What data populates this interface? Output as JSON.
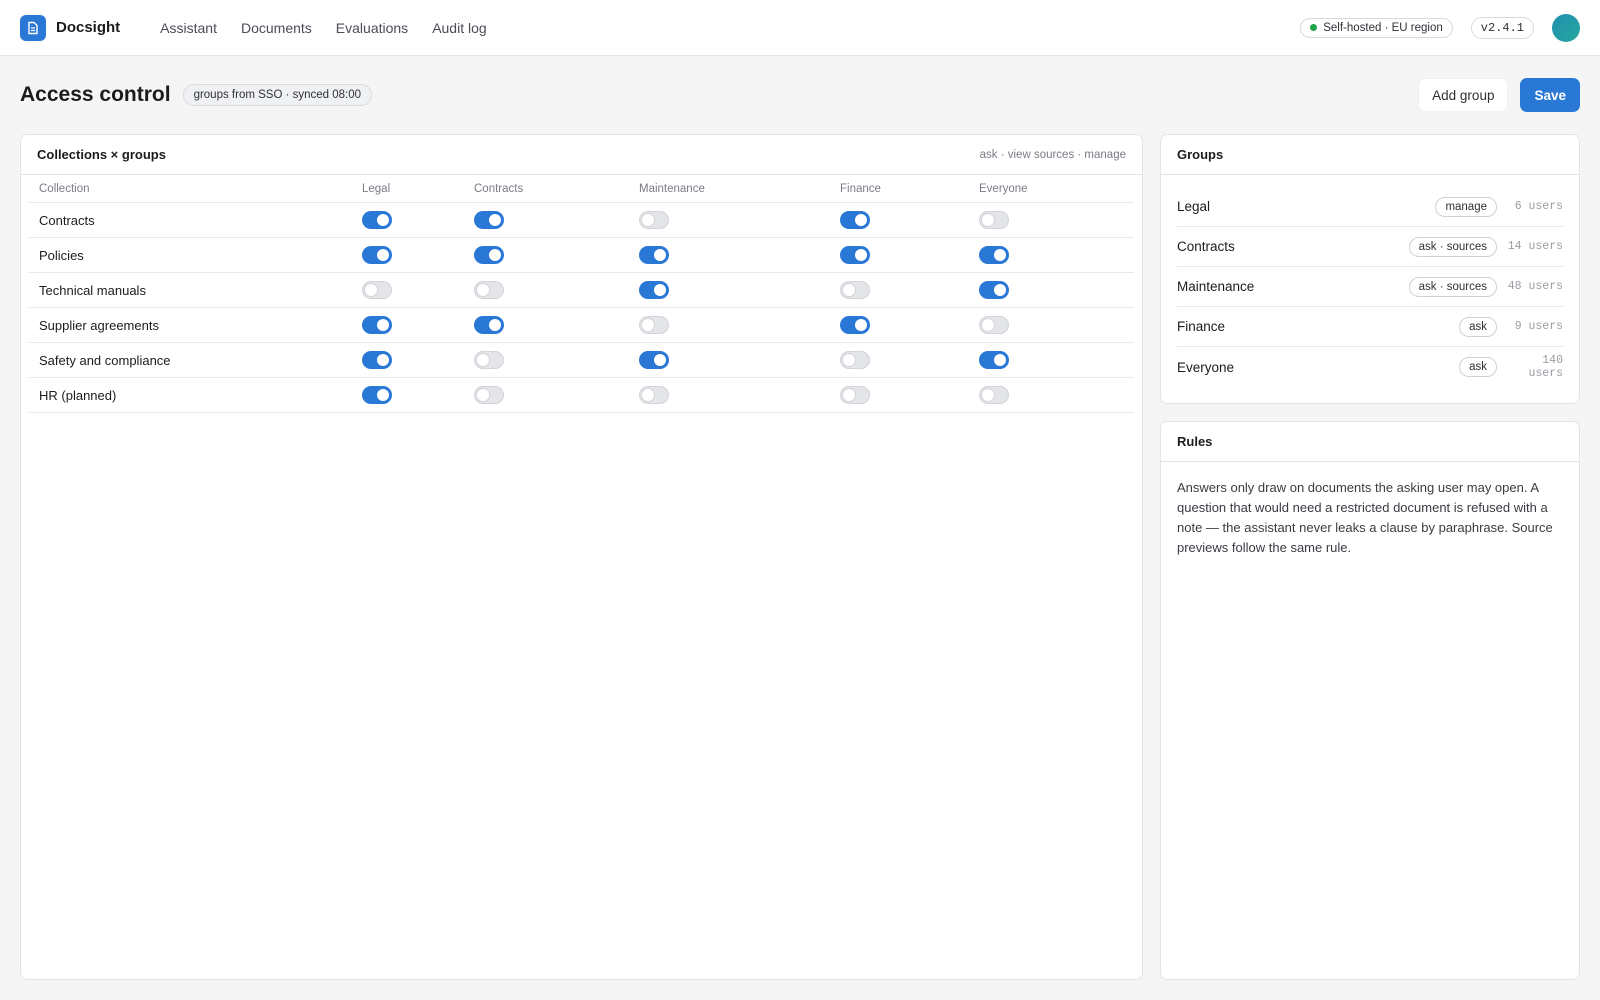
{
  "app": {
    "name": "Docsight"
  },
  "nav": [
    "Assistant",
    "Documents",
    "Evaluations",
    "Audit log"
  ],
  "top": {
    "hosting": "Self-hosted · EU region",
    "version": "v2.4.1",
    "status_color": "#22a54a"
  },
  "page": {
    "title": "Access control",
    "sso_badge": "groups from SSO · synced 08:00",
    "add_group": "Add group",
    "save": "Save"
  },
  "matrix": {
    "title": "Collections × groups",
    "legend": "ask · view sources · manage",
    "columns": [
      "Collection",
      "Legal",
      "Contracts",
      "Maintenance",
      "Finance",
      "Everyone"
    ],
    "rows": [
      {
        "name": "Contracts",
        "access": [
          true,
          true,
          false,
          true,
          false
        ]
      },
      {
        "name": "Policies",
        "access": [
          true,
          true,
          true,
          true,
          true
        ]
      },
      {
        "name": "Technical manuals",
        "access": [
          false,
          false,
          true,
          false,
          true
        ]
      },
      {
        "name": "Supplier agreements",
        "access": [
          true,
          true,
          false,
          true,
          false
        ]
      },
      {
        "name": "Safety and compliance",
        "access": [
          true,
          false,
          true,
          false,
          true
        ]
      },
      {
        "name": "HR (planned)",
        "access": [
          true,
          false,
          false,
          false,
          false
        ]
      }
    ]
  },
  "groups": {
    "title": "Groups",
    "items": [
      {
        "name": "Legal",
        "permission": "manage",
        "users": "6 users"
      },
      {
        "name": "Contracts",
        "permission": "ask · sources",
        "users": "14 users"
      },
      {
        "name": "Maintenance",
        "permission": "ask · sources",
        "users": "48 users"
      },
      {
        "name": "Finance",
        "permission": "ask",
        "users": "9 users"
      },
      {
        "name": "Everyone",
        "permission": "ask",
        "users": "140 users"
      }
    ]
  },
  "rules": {
    "title": "Rules",
    "text": "Answers only draw on documents the asking user may open. A question that would need a restricted document is refused with a note — the assistant never leaks a clause by paraphrase. Source previews follow the same rule."
  },
  "colors": {
    "accent": "#2a78d6",
    "toggle_off": "#e4e5e9"
  }
}
